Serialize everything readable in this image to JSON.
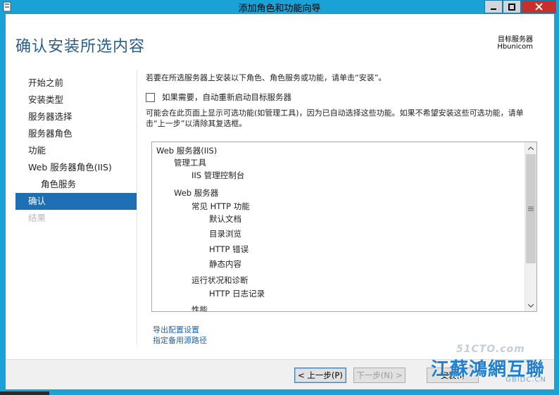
{
  "window": {
    "title": "添加角色和功能向导",
    "controls": [
      "minimize",
      "maximize",
      "close"
    ]
  },
  "header": {
    "title": "确认安装所选内容",
    "dest_label": "目标服务器",
    "dest_value": "Hbunicom"
  },
  "nav": {
    "items": [
      {
        "label": "开始之前",
        "state": "normal"
      },
      {
        "label": "安装类型",
        "state": "normal"
      },
      {
        "label": "服务器选择",
        "state": "normal"
      },
      {
        "label": "服务器角色",
        "state": "normal"
      },
      {
        "label": "功能",
        "state": "normal"
      },
      {
        "label": "Web 服务器角色(IIS)",
        "state": "normal"
      },
      {
        "label": "角色服务",
        "state": "sub"
      },
      {
        "label": "确认",
        "state": "active"
      },
      {
        "label": "结果",
        "state": "disabled"
      }
    ]
  },
  "content": {
    "intro": "若要在所选服务器上安装以下角色、角色服务或功能，请单击“安装”。",
    "restart_checkbox_label": "如果需要，自动重新启动目标服务器",
    "restart_checked": false,
    "note": "可能会在此页面上显示可选功能(如管理工具)，因为已自动选择这些功能。如果不希望安装这些可选功能，请单击“上一步”以清除其复选框。",
    "tree": [
      "Web 服务器(IIS)",
      "管理工具",
      "IIS 管理控制台",
      "Web 服务器",
      "常见 HTTP 功能",
      "默认文档",
      "目录浏览",
      "HTTP 错误",
      "静态内容",
      "运行状况和诊断",
      "HTTP 日志记录",
      "性能"
    ],
    "export_link": "导出配置设置",
    "alt_source_link": "指定备用源路径"
  },
  "footer": {
    "prev": "< 上一步(P)",
    "next": "下一步(N) >",
    "install": "安装(I)"
  },
  "watermark": {
    "top": "51CTO.com",
    "main": "江蘇鴻網互聯",
    "bottom": "GBIDC.CN"
  },
  "colors": {
    "title_bar": "#1aa1d6",
    "header_text": "#2a5e86",
    "nav_active": "#1f6fb4",
    "link": "#1d63b8",
    "close_button": "#c7302a"
  }
}
